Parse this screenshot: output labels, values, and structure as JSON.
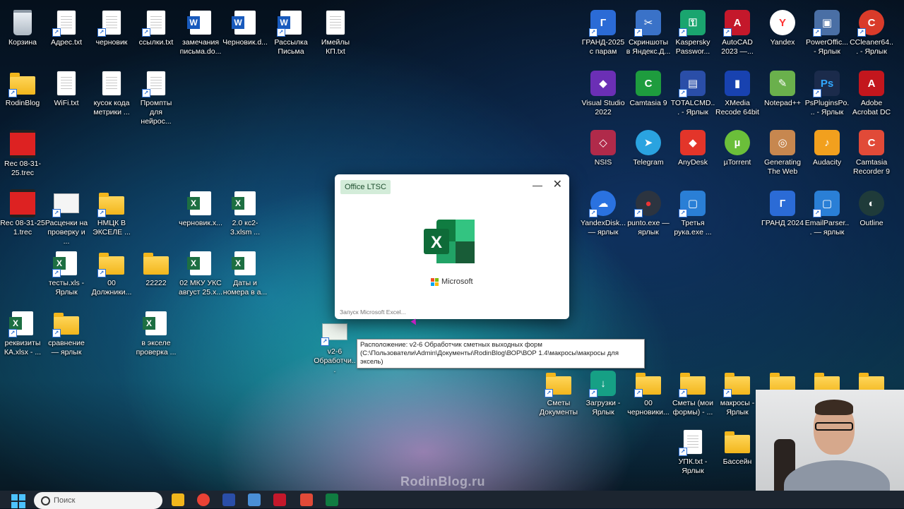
{
  "desktop": {
    "left_icons": [
      {
        "label": "Корзина",
        "kind": "recycle"
      },
      {
        "label": "Адрес.txt",
        "kind": "doc-shortcut"
      },
      {
        "label": "черновик",
        "kind": "doc-shortcut"
      },
      {
        "label": "ссылки.txt",
        "kind": "doc-shortcut"
      },
      {
        "label": "замечания письма.do...",
        "kind": "word"
      },
      {
        "label": "Черновик.d...",
        "kind": "word"
      },
      {
        "label": "Рассылка Письма",
        "kind": "word"
      },
      {
        "label": "Имейлы КП.txt",
        "kind": "doc"
      },
      {
        "label": "RodinBlog",
        "kind": "folder-shortcut"
      },
      {
        "label": "WiFi.txt",
        "kind": "doc"
      },
      {
        "label": "кусок кода метрики ...",
        "kind": "doc"
      },
      {
        "label": "Промпты для нейрос...",
        "kind": "doc-shortcut"
      },
      {
        "label": "Rec 08-31-25.trec",
        "kind": "video"
      },
      {
        "label": "Rec 08-31-25 1.trec",
        "kind": "video"
      },
      {
        "label": "Расценки на проверку и ...",
        "kind": "excel-shortcut"
      },
      {
        "label": "НМЦК В ЭКСЕЛЕ ...",
        "kind": "folder-shortcut"
      },
      {
        "label": "черновик.x...",
        "kind": "excel"
      },
      {
        "label": "2.0 кс2-3.xlsm ...",
        "kind": "excel"
      },
      {
        "label": "тесты.xls - Ярлык",
        "kind": "excel-shortcut"
      },
      {
        "label": "00 Должники...",
        "kind": "folder-shortcut"
      },
      {
        "label": "22222",
        "kind": "folder"
      },
      {
        "label": "02 МКУ УКС август 25.x...",
        "kind": "excel"
      },
      {
        "label": "Даты и номера в а...",
        "kind": "excel"
      },
      {
        "label": "реквизиты КА.xlsx - ...",
        "kind": "excel-shortcut"
      },
      {
        "label": "сравнение — ярлык",
        "kind": "folder-shortcut"
      },
      {
        "label": "в экселе проверка ...",
        "kind": "excel"
      },
      {
        "label": "v2-6 Обработчи...",
        "kind": "excel-shortcut"
      }
    ],
    "right_icons": [
      {
        "label": "ГРАНД-2025 с парам",
        "color": "#2b6bd6",
        "glyph": "Г"
      },
      {
        "label": "Скриншоты в Яндекс.Д...",
        "color": "#3a72c8",
        "glyph": "✂"
      },
      {
        "label": "Kaspersky Passwor...",
        "color": "#1aa56f",
        "glyph": "⚿"
      },
      {
        "label": "AutoCAD 2023 —...",
        "color": "#c4182b",
        "glyph": "A"
      },
      {
        "label": "Yandex",
        "color": "#ffffff",
        "glyph": "Y"
      },
      {
        "label": "PowerOffic... - Ярлык",
        "color": "#4a6fa5",
        "glyph": "▣"
      },
      {
        "label": "CCleaner64... - Ярлык",
        "color": "#d93b2a",
        "glyph": "C"
      },
      {
        "label": "Visual Studio 2022",
        "color": "#6b2fb5",
        "glyph": "◆"
      },
      {
        "label": "Camtasia 9",
        "color": "#1e9c3e",
        "glyph": "C"
      },
      {
        "label": "TOTALCMD... - Ярлык",
        "color": "#2a4ea8",
        "glyph": "▤"
      },
      {
        "label": "XMedia Recode 64bit",
        "color": "#1842b0",
        "glyph": "▮"
      },
      {
        "label": "Notepad++",
        "color": "#6ab04c",
        "glyph": "✎"
      },
      {
        "label": "PsPluginsPo... - Ярлык",
        "color": "#1b2b4b",
        "glyph": "Ps"
      },
      {
        "label": "Adobe Acrobat DC",
        "color": "#c3161d",
        "glyph": "A"
      },
      {
        "label": "NSIS",
        "color": "#b02a4a",
        "glyph": "◇"
      },
      {
        "label": "Telegram",
        "color": "#2aa3e0",
        "glyph": "➤"
      },
      {
        "label": "AnyDesk",
        "color": "#e3352a",
        "glyph": "◆"
      },
      {
        "label": "µTorrent",
        "color": "#6bbf3a",
        "glyph": "µ"
      },
      {
        "label": "Generating The Web",
        "color": "#c7874f",
        "glyph": "◎"
      },
      {
        "label": "Audacity",
        "color": "#f2a01e",
        "glyph": "♪"
      },
      {
        "label": "Camtasia Recorder 9",
        "color": "#e14a38",
        "glyph": "C"
      },
      {
        "label": "YandexDisk... — ярлык",
        "color": "#2a72e0",
        "glyph": "☁"
      },
      {
        "label": "punto.exe — ярлык",
        "color": "#2c3440",
        "glyph": "●"
      },
      {
        "label": "Третья рука.exe ...",
        "color": "#2a7fd6",
        "glyph": "▢"
      },
      {
        "label": "ГРАНД 2024",
        "color": "#2b6bd6",
        "glyph": "Г"
      },
      {
        "label": "EmailParser... — ярлык",
        "color": "#2a7fd6",
        "glyph": "▢"
      },
      {
        "label": "Outline",
        "color": "#1f3b3a",
        "glyph": "◐"
      },
      {
        "label": "Сметы Документы",
        "color": "#f2b61c",
        "glyph": ""
      },
      {
        "label": "Загрузки - Ярлык",
        "color": "#16a085",
        "glyph": "↓"
      },
      {
        "label": "00 черновики...",
        "color": "#f2b61c",
        "glyph": ""
      },
      {
        "label": "Сметы (мои формы) - ...",
        "color": "#f2b61c",
        "glyph": ""
      },
      {
        "label": "макросы - Ярлык",
        "color": "#f2b61c",
        "glyph": ""
      },
      {
        "label": "УПК.txt - Ярлык",
        "color": "#ffffff",
        "glyph": ""
      },
      {
        "label": "Бассейн",
        "color": "#f2b61c",
        "glyph": ""
      }
    ]
  },
  "splash": {
    "tag": "Office LTSC",
    "minimize": "—",
    "close": "✕",
    "brand": "Microsoft",
    "status": "Запуск Microsoft Excel..."
  },
  "tooltip": {
    "text": "Расположение: v2-6 Обработчик сметных выходных форм (C:\\Пользователи\\Admin\\Документы\\RodinBlog\\ВОР\\ВОР 1.4\\макросы\\макросы для эксель)"
  },
  "watermark": "RodinBlog.ru",
  "taskbar": {
    "search_placeholder": "Поиск"
  }
}
